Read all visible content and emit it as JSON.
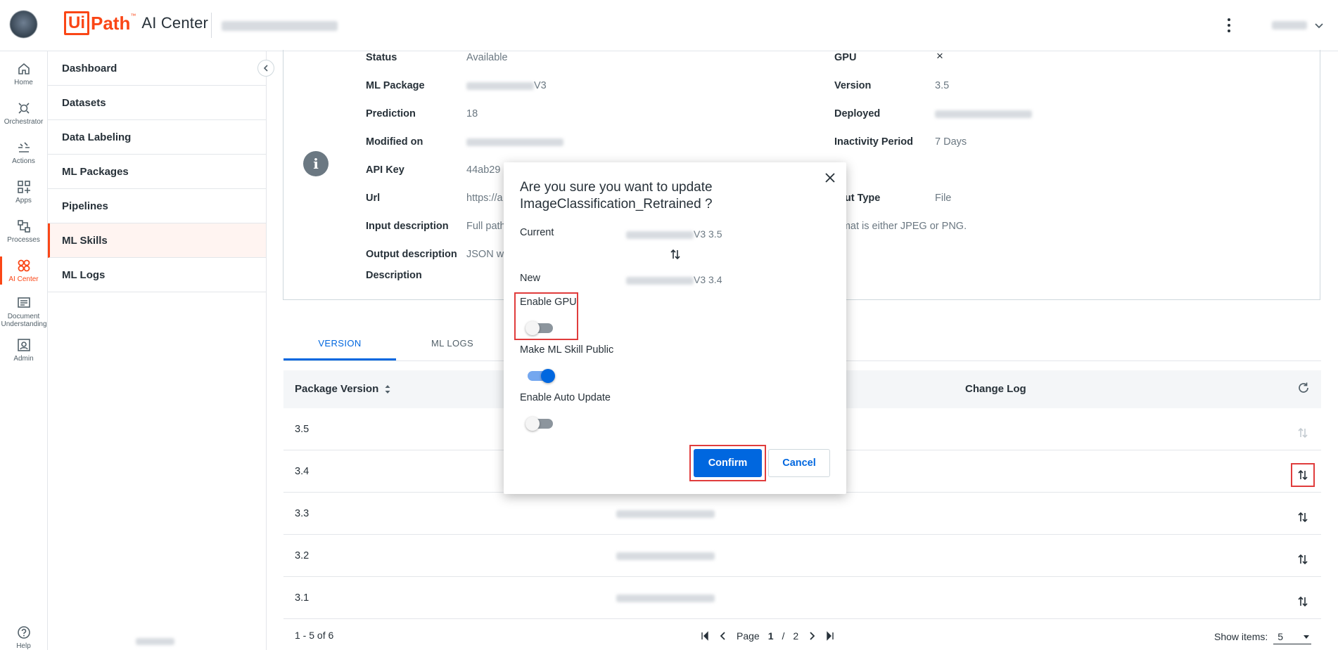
{
  "app": {
    "brand_ui": "Ui",
    "brand_path": "Path",
    "brand_tm": "™",
    "brand_product": "AI Center"
  },
  "rail": {
    "items": [
      {
        "label": "Home",
        "icon": "home-icon"
      },
      {
        "label": "Orchestrator",
        "icon": "orchestrator-icon"
      },
      {
        "label": "Actions",
        "icon": "actions-icon"
      },
      {
        "label": "Apps",
        "icon": "apps-icon"
      },
      {
        "label": "Processes",
        "icon": "processes-icon"
      },
      {
        "label": "AI Center",
        "icon": "ai-center-icon",
        "active": true
      },
      {
        "label": "Document Understanding",
        "icon": "document-understanding-icon"
      },
      {
        "label": "Admin",
        "icon": "admin-icon"
      },
      {
        "label": "Help",
        "icon": "help-icon"
      }
    ]
  },
  "sidenav": {
    "items": [
      {
        "label": "Dashboard"
      },
      {
        "label": "Datasets"
      },
      {
        "label": "Data Labeling"
      },
      {
        "label": "ML Packages"
      },
      {
        "label": "Pipelines"
      },
      {
        "label": "ML Skills",
        "active": true
      },
      {
        "label": "ML Logs"
      }
    ]
  },
  "details": {
    "status_label": "Status",
    "status_value": "Available",
    "ml_package_label": "ML Package",
    "ml_package_suffix": "V3",
    "prediction_label": "Prediction",
    "prediction_value": "18",
    "modified_label": "Modified on",
    "api_key_label": "API Key",
    "api_key_value": "44ab29",
    "url_label": "Url",
    "url_value": "https://a",
    "input_desc_label": "Input description",
    "input_desc_value": "Full path",
    "output_desc_label": "Output description",
    "output_desc_value": "JSON wi",
    "description_label": "Description",
    "gpu_label": "GPU",
    "gpu_value": "×",
    "version_label": "Version",
    "version_value": "3.5",
    "deployed_label": "Deployed",
    "inactivity_label": "Inactivity Period",
    "inactivity_value": "7 Days",
    "input_type_label": "put Type",
    "input_type_value": "File",
    "input_desc_tail": "rmat is either JPEG or PNG."
  },
  "tabs": {
    "version": "VERSION",
    "ml_logs": "ML LOGS"
  },
  "table": {
    "col_package_version": "Package Version",
    "col_change_log": "Change Log",
    "rows": [
      {
        "version": "3.5"
      },
      {
        "version": "3.4"
      },
      {
        "version": "3.3"
      },
      {
        "version": "3.2"
      },
      {
        "version": "3.1"
      }
    ]
  },
  "pagination": {
    "range": "1 - 5 of 6",
    "page_word": "Page",
    "current_page": "1",
    "separator": "/",
    "total_pages": "2",
    "show_items_label": "Show items:",
    "show_items_value": "5"
  },
  "modal": {
    "title_line1": "Are you sure you want to update",
    "title_line2": "ImageClassification_Retrained ?",
    "current_label": "Current",
    "current_value": "V3 3.5",
    "new_label": "New",
    "new_value": "V3 3.4",
    "enable_gpu_label": "Enable GPU",
    "enable_gpu": false,
    "make_public_label": "Make ML Skill Public",
    "make_public": true,
    "auto_update_label": "Enable Auto Update",
    "auto_update": false,
    "confirm_label": "Confirm",
    "cancel_label": "Cancel"
  },
  "colors": {
    "brand_orange": "#fa4616",
    "primary_blue": "#0067df",
    "highlight_red": "#e03c3c"
  }
}
